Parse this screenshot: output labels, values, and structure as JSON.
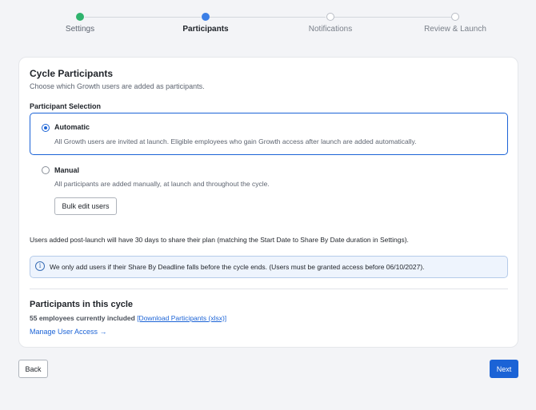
{
  "stepper": {
    "steps": [
      {
        "label": "Settings",
        "state": "done"
      },
      {
        "label": "Participants",
        "state": "active"
      },
      {
        "label": "Notifications",
        "state": "pending"
      },
      {
        "label": "Review & Launch",
        "state": "pending"
      }
    ]
  },
  "card": {
    "title": "Cycle Participants",
    "subtitle": "Choose which Growth users are added as participants.",
    "selection_label": "Participant Selection",
    "options": [
      {
        "title": "Automatic",
        "description": "All Growth users are invited at launch. Eligible employees who gain Growth access after launch are added automatically.",
        "selected": true
      },
      {
        "title": "Manual",
        "description": "All participants are added manually, at launch and throughout the cycle.",
        "selected": false
      }
    ],
    "bulk_edit_label": "Bulk edit users",
    "post_launch_note": "Users added post-launch will have 30 days to share their plan (matching the Start Date to Share By Date duration in Settings).",
    "info_icon": "info-icon",
    "info_text": "We only add users if their Share By Deadline falls before the cycle ends. (Users must be granted access before 06/10/2027).",
    "participants_title": "Participants in this cycle",
    "participants_count": "55 employees currently included",
    "download_link": "[Download Participants (xlsx)]",
    "manage_link": "Manage User Access →"
  },
  "footer": {
    "back_label": "Back",
    "next_label": "Next"
  },
  "colors": {
    "accent": "#1b63d6",
    "done": "#2fb36d",
    "active": "#3b7fe6"
  }
}
